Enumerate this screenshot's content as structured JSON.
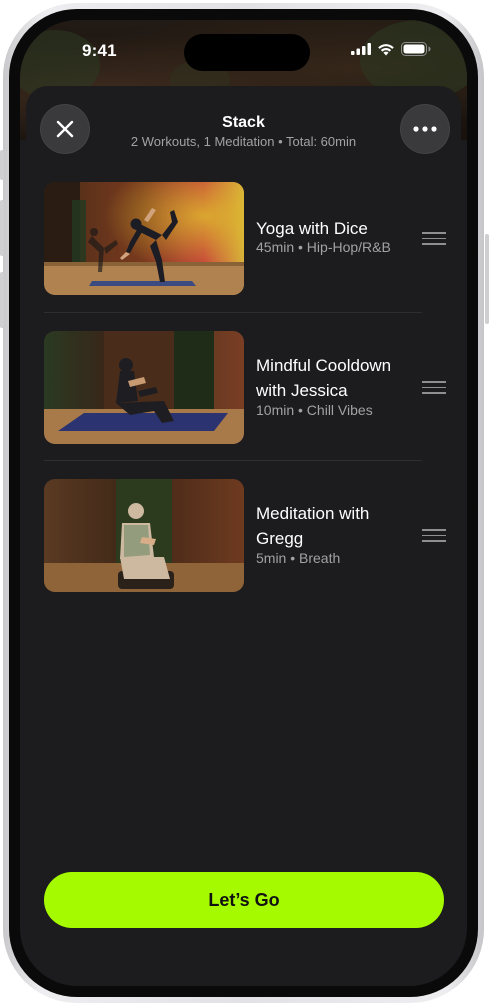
{
  "status_bar": {
    "time": "9:41"
  },
  "header": {
    "title": "Stack",
    "subtitle": "2 Workouts, 1 Meditation • Total: 60min"
  },
  "workouts": [
    {
      "title": "Yoga with Dice",
      "meta": "45min • Hip-Hop/R&B"
    },
    {
      "title": "Mindful Cooldown with Jessica",
      "meta": "10min • Chill Vibes"
    },
    {
      "title": "Meditation with Gregg",
      "meta": "5min • Breath"
    }
  ],
  "cta": {
    "label": "Let’s Go"
  },
  "colors": {
    "accent": "#a6fa00",
    "sheet": "#1c1c1e",
    "button": "#3a3a3c",
    "secondary_text": "#a1a1a6"
  },
  "icons": [
    "close-icon",
    "more-icon",
    "signal-icon",
    "wifi-icon",
    "battery-icon",
    "drag-handle-icon"
  ]
}
